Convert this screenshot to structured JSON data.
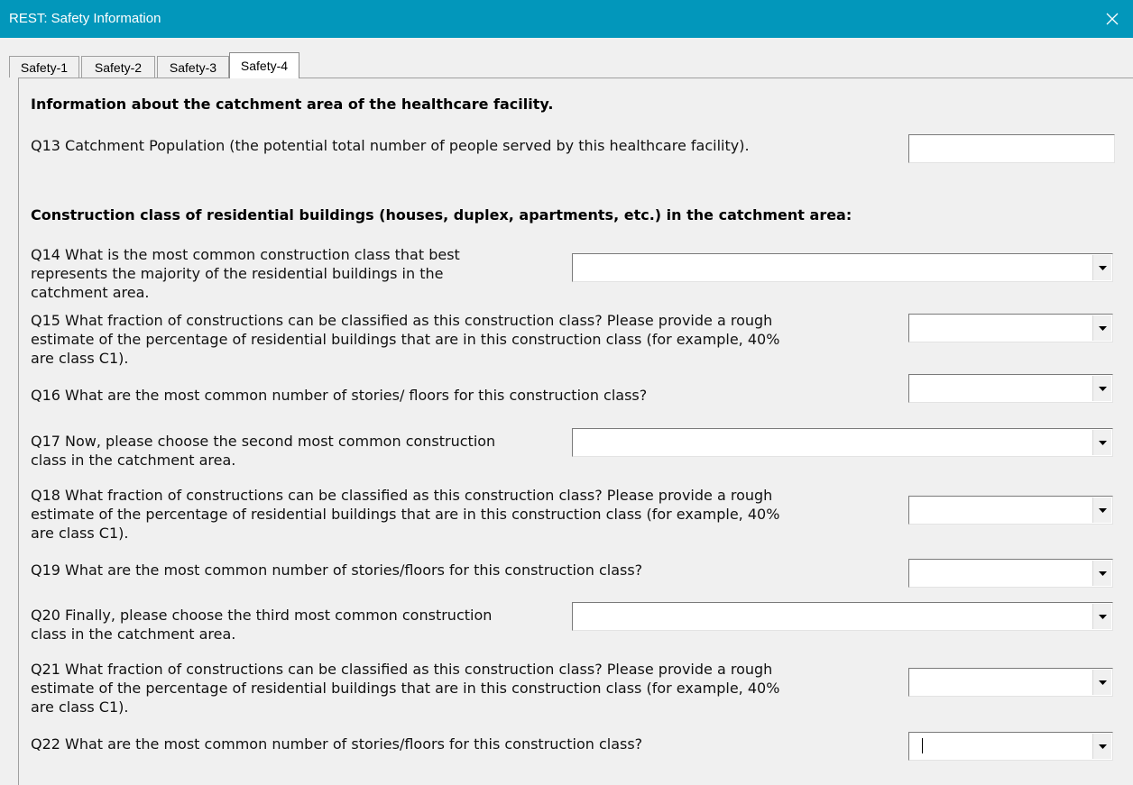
{
  "window": {
    "title": "REST: Safety Information",
    "close_icon": "close-icon"
  },
  "tabs": [
    {
      "label": "Safety-1",
      "active": false
    },
    {
      "label": "Safety-2",
      "active": false
    },
    {
      "label": "Safety-3",
      "active": false
    },
    {
      "label": "Safety-4",
      "active": true
    }
  ],
  "section1": {
    "heading": "Information about the catchment area of the healthcare facility.",
    "q13": {
      "label": "Q13 Catchment Population (the potential total number of people served by this healthcare facility).",
      "value": ""
    }
  },
  "section2": {
    "heading": "Construction class of residential buildings (houses, duplex, apartments, etc.) in the catchment area:",
    "questions": [
      {
        "id": "q14",
        "lines": [
          "Q14 What is the most common construction class that best",
          "represents the majority of the residential buildings in the",
          "catchment area."
        ],
        "value": ""
      },
      {
        "id": "q15",
        "lines": [
          "Q15 What fraction of constructions can be classified as this construction class? Please provide a rough",
          "estimate of the percentage of residential buildings that are in this construction class (for example, 40%",
          "are class C1)."
        ],
        "value": ""
      },
      {
        "id": "q16",
        "lines": [
          "Q16 What are the most common number of stories/ floors for this construction class?"
        ],
        "value": ""
      },
      {
        "id": "q17",
        "lines": [
          "Q17 Now, please choose the second most common construction",
          "class in the catchment area."
        ],
        "value": ""
      },
      {
        "id": "q18",
        "lines": [
          "Q18 What fraction of constructions can be classified as this construction class? Please provide a rough",
          "estimate of the percentage of residential buildings that are in this construction class (for example, 40%",
          "are class C1)."
        ],
        "value": ""
      },
      {
        "id": "q19",
        "lines": [
          "Q19 What are the most common number of stories/floors for this construction class?"
        ],
        "value": ""
      },
      {
        "id": "q20",
        "lines": [
          "Q20 Finally, please choose the third most common construction",
          "class in the catchment area."
        ],
        "value": ""
      },
      {
        "id": "q21",
        "lines": [
          "Q21 What fraction of constructions can be classified as this construction class? Please provide a rough",
          "estimate of the percentage of residential buildings that are in this construction class (for example, 40%",
          "are class C1)."
        ],
        "value": ""
      },
      {
        "id": "q22",
        "lines": [
          "Q22 What are the most common number of stories/floors for this construction class?"
        ],
        "value": "",
        "focused": true
      }
    ]
  },
  "icons": {
    "dropdown": "chevron-down-icon"
  }
}
